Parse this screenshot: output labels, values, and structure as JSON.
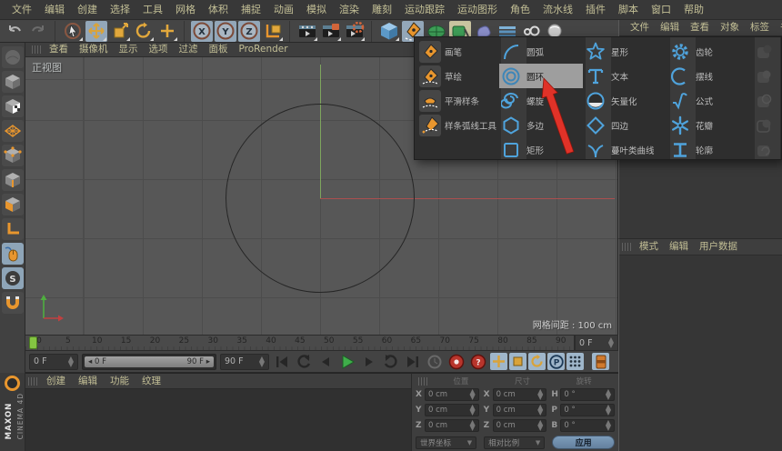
{
  "colors": {
    "accent_blue": "#4fa3dc",
    "icon_orange": "#e8962e",
    "menu_text": "#c3bf96",
    "highlight_gray": "#9e9e9e",
    "play_green": "#3fae4a",
    "playhead_green": "#84c542",
    "record_red": "#b8352c",
    "arrow_red": "#e03228",
    "apply_blue": "#7d9cba",
    "viewport_bg": "#575757"
  },
  "menubar": {
    "items": [
      "文件",
      "编辑",
      "创建",
      "选择",
      "工具",
      "网格",
      "体积",
      "捕捉",
      "动画",
      "模拟",
      "渲染",
      "雕刻",
      "运动跟踪",
      "运动图形",
      "角色",
      "流水线",
      "插件",
      "脚本",
      "窗口",
      "帮助"
    ]
  },
  "toolbar": {
    "icons": [
      "undo-icon",
      "redo-icon",
      "live-selection-icon",
      "move-icon",
      "scale-icon",
      "rotate-icon",
      "last-tool-icon",
      "x-axis-lock-icon",
      "y-axis-lock-icon",
      "z-axis-lock-icon",
      "coordinate-system-icon",
      "render-view-icon",
      "render-picture-viewer-icon",
      "render-settings-icon",
      "add-cube-icon",
      "spline-pen-icon",
      "subdivision-surface-icon",
      "generator-icon",
      "volume-icon",
      "field-icon",
      "metaball-icon",
      "simulation-icon"
    ]
  },
  "left_toolbar": {
    "icons": [
      "sculpt-mode-icon",
      "model-mode-icon",
      "texture-mode-icon",
      "workplane-mode-icon",
      "points-mode-icon",
      "edges-mode-icon",
      "polygons-mode-icon",
      "axis-mode-icon",
      "viewport-solo-icon",
      "snap-icon",
      "magnet-icon"
    ]
  },
  "viewport": {
    "menu": [
      "查看",
      "摄像机",
      "显示",
      "选项",
      "过滤",
      "面板",
      "ProRender"
    ],
    "view_label": "正视图",
    "grid_spacing_label": "网格间距 : 100 cm"
  },
  "popup": {
    "pen_tools": [
      {
        "label": "画笔",
        "icon": "pen-icon"
      },
      {
        "label": "草绘",
        "icon": "sketch-icon"
      },
      {
        "label": "平滑样条",
        "icon": "spline-smooth-icon"
      },
      {
        "label": "样条弧线工具",
        "icon": "spline-arc-icon"
      }
    ],
    "splines_col1": [
      {
        "label": "圆弧",
        "icon": "arc-icon"
      },
      {
        "label": "圆环",
        "icon": "circle-spline-icon",
        "highlighted": true
      },
      {
        "label": "螺旋",
        "icon": "helix-icon"
      },
      {
        "label": "多边",
        "icon": "nside-icon"
      },
      {
        "label": "矩形",
        "icon": "rectangle-icon"
      }
    ],
    "splines_col2": [
      {
        "label": "星形",
        "icon": "star-icon"
      },
      {
        "label": "文本",
        "icon": "text-icon"
      },
      {
        "label": "矢量化",
        "icon": "vectorizer-icon"
      },
      {
        "label": "四边",
        "icon": "foursides-icon"
      },
      {
        "label": "蔓叶类曲线",
        "icon": "cissoid-icon"
      }
    ],
    "splines_col3": [
      {
        "label": "齿轮",
        "icon": "gear-icon"
      },
      {
        "label": "摆线",
        "icon": "cycloid-icon"
      },
      {
        "label": "公式",
        "icon": "formula-icon"
      },
      {
        "label": "花瓣",
        "icon": "flower-icon"
      },
      {
        "label": "轮廓",
        "icon": "profile-icon"
      }
    ],
    "disabled_icons": [
      "spline-boolean-icon",
      "spline-boolean-icon",
      "spline-boolean-icon",
      "spline-boolean-icon",
      "spline-boolean-icon"
    ]
  },
  "object_manager": {
    "menu": [
      "文件",
      "编辑",
      "查看",
      "对象",
      "标签",
      "书签"
    ]
  },
  "attribute_manager": {
    "menu": [
      "模式",
      "编辑",
      "用户数据"
    ]
  },
  "material_manager": {
    "menu": [
      "创建",
      "编辑",
      "功能",
      "纹理"
    ]
  },
  "timeline": {
    "ticks": [
      "0",
      "5",
      "10",
      "15",
      "20",
      "25",
      "30",
      "35",
      "40",
      "45",
      "50",
      "55",
      "60",
      "65",
      "70",
      "75",
      "80",
      "85",
      "90"
    ],
    "current_frame": "0 F",
    "range_start": "0 F",
    "range_end": "90 F",
    "end_frame": "90 F",
    "preview_frame": "0 F",
    "transport_icons": [
      "goto-start-icon",
      "play-backward-icon",
      "previous-frame-icon",
      "play-forward-icon",
      "next-frame-icon",
      "loop-icon",
      "goto-end-icon"
    ],
    "record_icons": [
      "record-disabled-icon",
      "record-objects-icon",
      "autokey-icon"
    ],
    "key_toggle_icons": [
      "key-position-icon",
      "key-scale-icon",
      "key-rotation-icon",
      "key-parameter-icon",
      "key-pla-icon",
      "timeline-window-icon"
    ]
  },
  "coordinates": {
    "headers": [
      "位置",
      "尺寸",
      "旋转"
    ],
    "position": {
      "labels": [
        "X",
        "Y",
        "Z"
      ],
      "values": [
        "0 cm",
        "0 cm",
        "0 cm"
      ]
    },
    "size": {
      "labels": [
        "X",
        "Y",
        "Z"
      ],
      "values": [
        "0 cm",
        "0 cm",
        "0 cm"
      ]
    },
    "rotation": {
      "labels": [
        "H",
        "P",
        "B"
      ],
      "values": [
        "0 °",
        "0 °",
        "0 °"
      ]
    },
    "mode_dropdown": "世界坐标",
    "ratio_dropdown": "相对比例",
    "apply_label": "应用"
  },
  "branding": {
    "company": "MAXON",
    "product": "CINEMA 4D"
  }
}
